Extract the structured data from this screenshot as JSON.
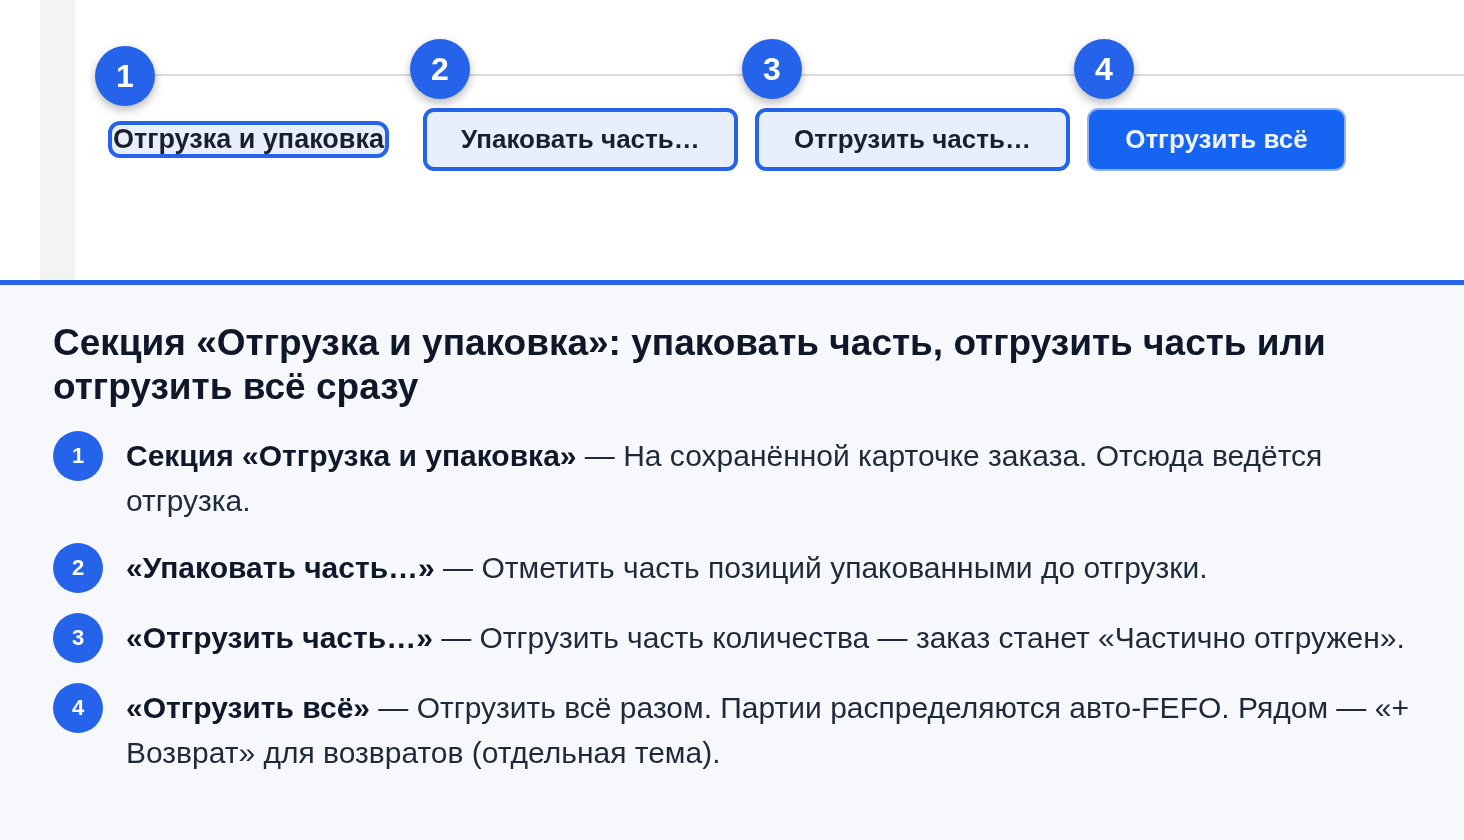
{
  "toolbar": {
    "items": [
      {
        "kind": "label",
        "label": "Отгрузка и упаковка",
        "highlighted": true,
        "callout": "1"
      },
      {
        "kind": "secondary",
        "label": "Упаковать часть…",
        "highlighted": true,
        "callout": "2"
      },
      {
        "kind": "secondary",
        "label": "Отгрузить часть…",
        "highlighted": true,
        "callout": "3"
      },
      {
        "kind": "primary",
        "label": "Отгрузить всё",
        "highlighted": true,
        "callout": "4"
      }
    ]
  },
  "description": {
    "title": "Секция «Отгрузка и упаковка»: упаковать часть, отгрузить часть или отгрузить всё сразу",
    "items": [
      {
        "number": "1",
        "text": "**Секция «Отгрузка и упаковка»** — На сохранённой карточке заказа. Отсюда ведётся отгрузка."
      },
      {
        "number": "2",
        "text": "**«Упаковать часть…»** — Отметить часть позиций упакованными до отгрузки."
      },
      {
        "number": "3",
        "text": "**«Отгрузить часть…»** — Отгрузить часть количества — заказ станет «Частично отгружен»."
      },
      {
        "number": "4",
        "text": "**«Отгрузить всё»** — Отгрузить всё разом. Партии распределяются авто-FEFO. Рядом — «+ Возврат» для возвратов (отдельная тема)."
      }
    ]
  }
}
